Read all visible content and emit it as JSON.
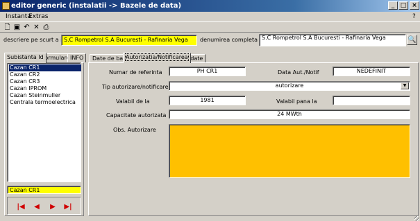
{
  "window": {
    "title": "editor generic (instalatii -> Bazele de data)"
  },
  "window_buttons": {
    "minimize": "_",
    "maximize": "□",
    "close": "×"
  },
  "menu": {
    "items": [
      "Instanta",
      "Extras"
    ],
    "help": "?"
  },
  "toolbar": {
    "icons": [
      "new-icon",
      "save-icon",
      "undo-icon",
      "delete-icon",
      "print-icon"
    ]
  },
  "header": {
    "short_desc_label": "descriere pe scurt a inst...",
    "short_desc_value": "S.C  Rompetrol S.A Bucuresti - Rafinaria Vega",
    "full_name_label": "denumirea completa a in...",
    "full_name_value": "S.C  Rompetrol S.A Bucuresti - Rafinaria Vega"
  },
  "left_tabs": [
    "Subistanta Id",
    "Formulare",
    "INFO"
  ],
  "list_items": [
    "Cazan CR1",
    "Cazan CR2",
    "Cazan CR3",
    "Cazan IPROM",
    "Cazan Steinmuller",
    "Centrala termoelectrica"
  ],
  "selected_item": "Cazan CR1",
  "nav": {
    "first": "|◀",
    "prev": "◀",
    "next": "▶",
    "last": "▶|"
  },
  "right_tabs": [
    "Date de baza",
    "Autorizatia/Notificarea",
    "Alte date"
  ],
  "form": {
    "ref_label": "Numar de referinta",
    "ref_value": "PH CR1",
    "date_label": "Data Aut./Notif",
    "date_value": "NEDEFINIT",
    "type_label": "Tip autorizare/notificarea",
    "type_value": "autorizare",
    "valid_from_label": "Valabil de la",
    "valid_from_value": "1981",
    "valid_to_label": "Valabil pana la",
    "valid_to_value": "",
    "capacity_label": "Capacitate autorizata",
    "capacity_value": "24 MWth",
    "obs_label": "Obs. Autorizare",
    "obs_value": ""
  },
  "colors": {
    "highlight": "#ffff00",
    "obs_background": "#ffc000",
    "selection": "#0a246a",
    "nav_arrows": "#d00000"
  }
}
